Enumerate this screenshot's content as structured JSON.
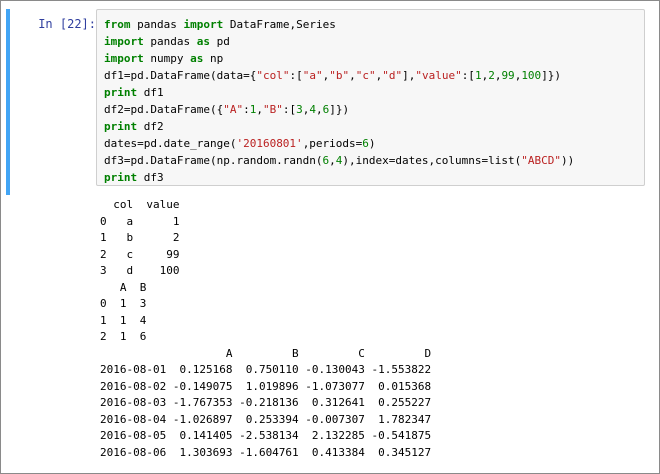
{
  "cell": {
    "prompt": "In  [22]:",
    "code_lines": [
      [
        {
          "t": "from",
          "k": "kw"
        },
        {
          "t": " pandas ",
          "k": "plain"
        },
        {
          "t": "import",
          "k": "kw"
        },
        {
          "t": " DataFrame,Series",
          "k": "plain"
        }
      ],
      [
        {
          "t": "import",
          "k": "kw"
        },
        {
          "t": " pandas ",
          "k": "plain"
        },
        {
          "t": "as",
          "k": "kw"
        },
        {
          "t": " pd",
          "k": "plain"
        }
      ],
      [
        {
          "t": "import",
          "k": "kw"
        },
        {
          "t": " numpy ",
          "k": "plain"
        },
        {
          "t": "as",
          "k": "kw"
        },
        {
          "t": " np",
          "k": "plain"
        }
      ],
      [
        {
          "t": "df1=pd.DataFrame(data={",
          "k": "plain"
        },
        {
          "t": "\"col\"",
          "k": "str"
        },
        {
          "t": ":[",
          "k": "plain"
        },
        {
          "t": "\"a\"",
          "k": "str"
        },
        {
          "t": ",",
          "k": "plain"
        },
        {
          "t": "\"b\"",
          "k": "str"
        },
        {
          "t": ",",
          "k": "plain"
        },
        {
          "t": "\"c\"",
          "k": "str"
        },
        {
          "t": ",",
          "k": "plain"
        },
        {
          "t": "\"d\"",
          "k": "str"
        },
        {
          "t": "],",
          "k": "plain"
        },
        {
          "t": "\"value\"",
          "k": "str"
        },
        {
          "t": ":[",
          "k": "plain"
        },
        {
          "t": "1",
          "k": "num"
        },
        {
          "t": ",",
          "k": "plain"
        },
        {
          "t": "2",
          "k": "num"
        },
        {
          "t": ",",
          "k": "plain"
        },
        {
          "t": "99",
          "k": "num"
        },
        {
          "t": ",",
          "k": "plain"
        },
        {
          "t": "100",
          "k": "num"
        },
        {
          "t": "]})",
          "k": "plain"
        }
      ],
      [
        {
          "t": "print",
          "k": "kw"
        },
        {
          "t": " df1",
          "k": "plain"
        }
      ],
      [
        {
          "t": "df2=pd.DataFrame({",
          "k": "plain"
        },
        {
          "t": "\"A\"",
          "k": "str"
        },
        {
          "t": ":",
          "k": "plain"
        },
        {
          "t": "1",
          "k": "num"
        },
        {
          "t": ",",
          "k": "plain"
        },
        {
          "t": "\"B\"",
          "k": "str"
        },
        {
          "t": ":[",
          "k": "plain"
        },
        {
          "t": "3",
          "k": "num"
        },
        {
          "t": ",",
          "k": "plain"
        },
        {
          "t": "4",
          "k": "num"
        },
        {
          "t": ",",
          "k": "plain"
        },
        {
          "t": "6",
          "k": "num"
        },
        {
          "t": "]})",
          "k": "plain"
        }
      ],
      [
        {
          "t": "print",
          "k": "kw"
        },
        {
          "t": " df2",
          "k": "plain"
        }
      ],
      [
        {
          "t": "dates=pd.date_range(",
          "k": "plain"
        },
        {
          "t": "'20160801'",
          "k": "str"
        },
        {
          "t": ",periods=",
          "k": "plain"
        },
        {
          "t": "6",
          "k": "num"
        },
        {
          "t": ")",
          "k": "plain"
        }
      ],
      [
        {
          "t": "df3=pd.DataFrame(np.random.randn(",
          "k": "plain"
        },
        {
          "t": "6",
          "k": "num"
        },
        {
          "t": ",",
          "k": "plain"
        },
        {
          "t": "4",
          "k": "num"
        },
        {
          "t": "),index=dates,columns=list(",
          "k": "plain"
        },
        {
          "t": "\"ABCD\"",
          "k": "str"
        },
        {
          "t": "))",
          "k": "plain"
        }
      ],
      [
        {
          "t": "print",
          "k": "kw"
        },
        {
          "t": " df3",
          "k": "plain"
        }
      ]
    ],
    "output_lines": [
      "  col  value",
      "0   a      1",
      "1   b      2",
      "2   c     99",
      "3   d    100",
      "   A  B",
      "0  1  3",
      "1  1  4",
      "2  1  6",
      "                   A         B         C         D",
      "2016-08-01  0.125168  0.750110 -0.130043 -1.553822",
      "2016-08-02 -0.149075  1.019896 -1.073077  0.015368",
      "2016-08-03 -1.767353 -0.218136  0.312641  0.255227",
      "2016-08-04 -1.026897  0.253394 -0.007307  1.782347",
      "2016-08-05  0.141405 -2.538134  2.132285 -0.541875",
      "2016-08-06  1.303693 -1.604761  0.413384  0.345127"
    ]
  },
  "colors": {
    "cell_selected_bar": "#42a5f5",
    "prompt": "#303f9f",
    "keyword": "#008000",
    "string": "#ba2121",
    "number": "#008000",
    "input_background": "#f7f7f7"
  }
}
